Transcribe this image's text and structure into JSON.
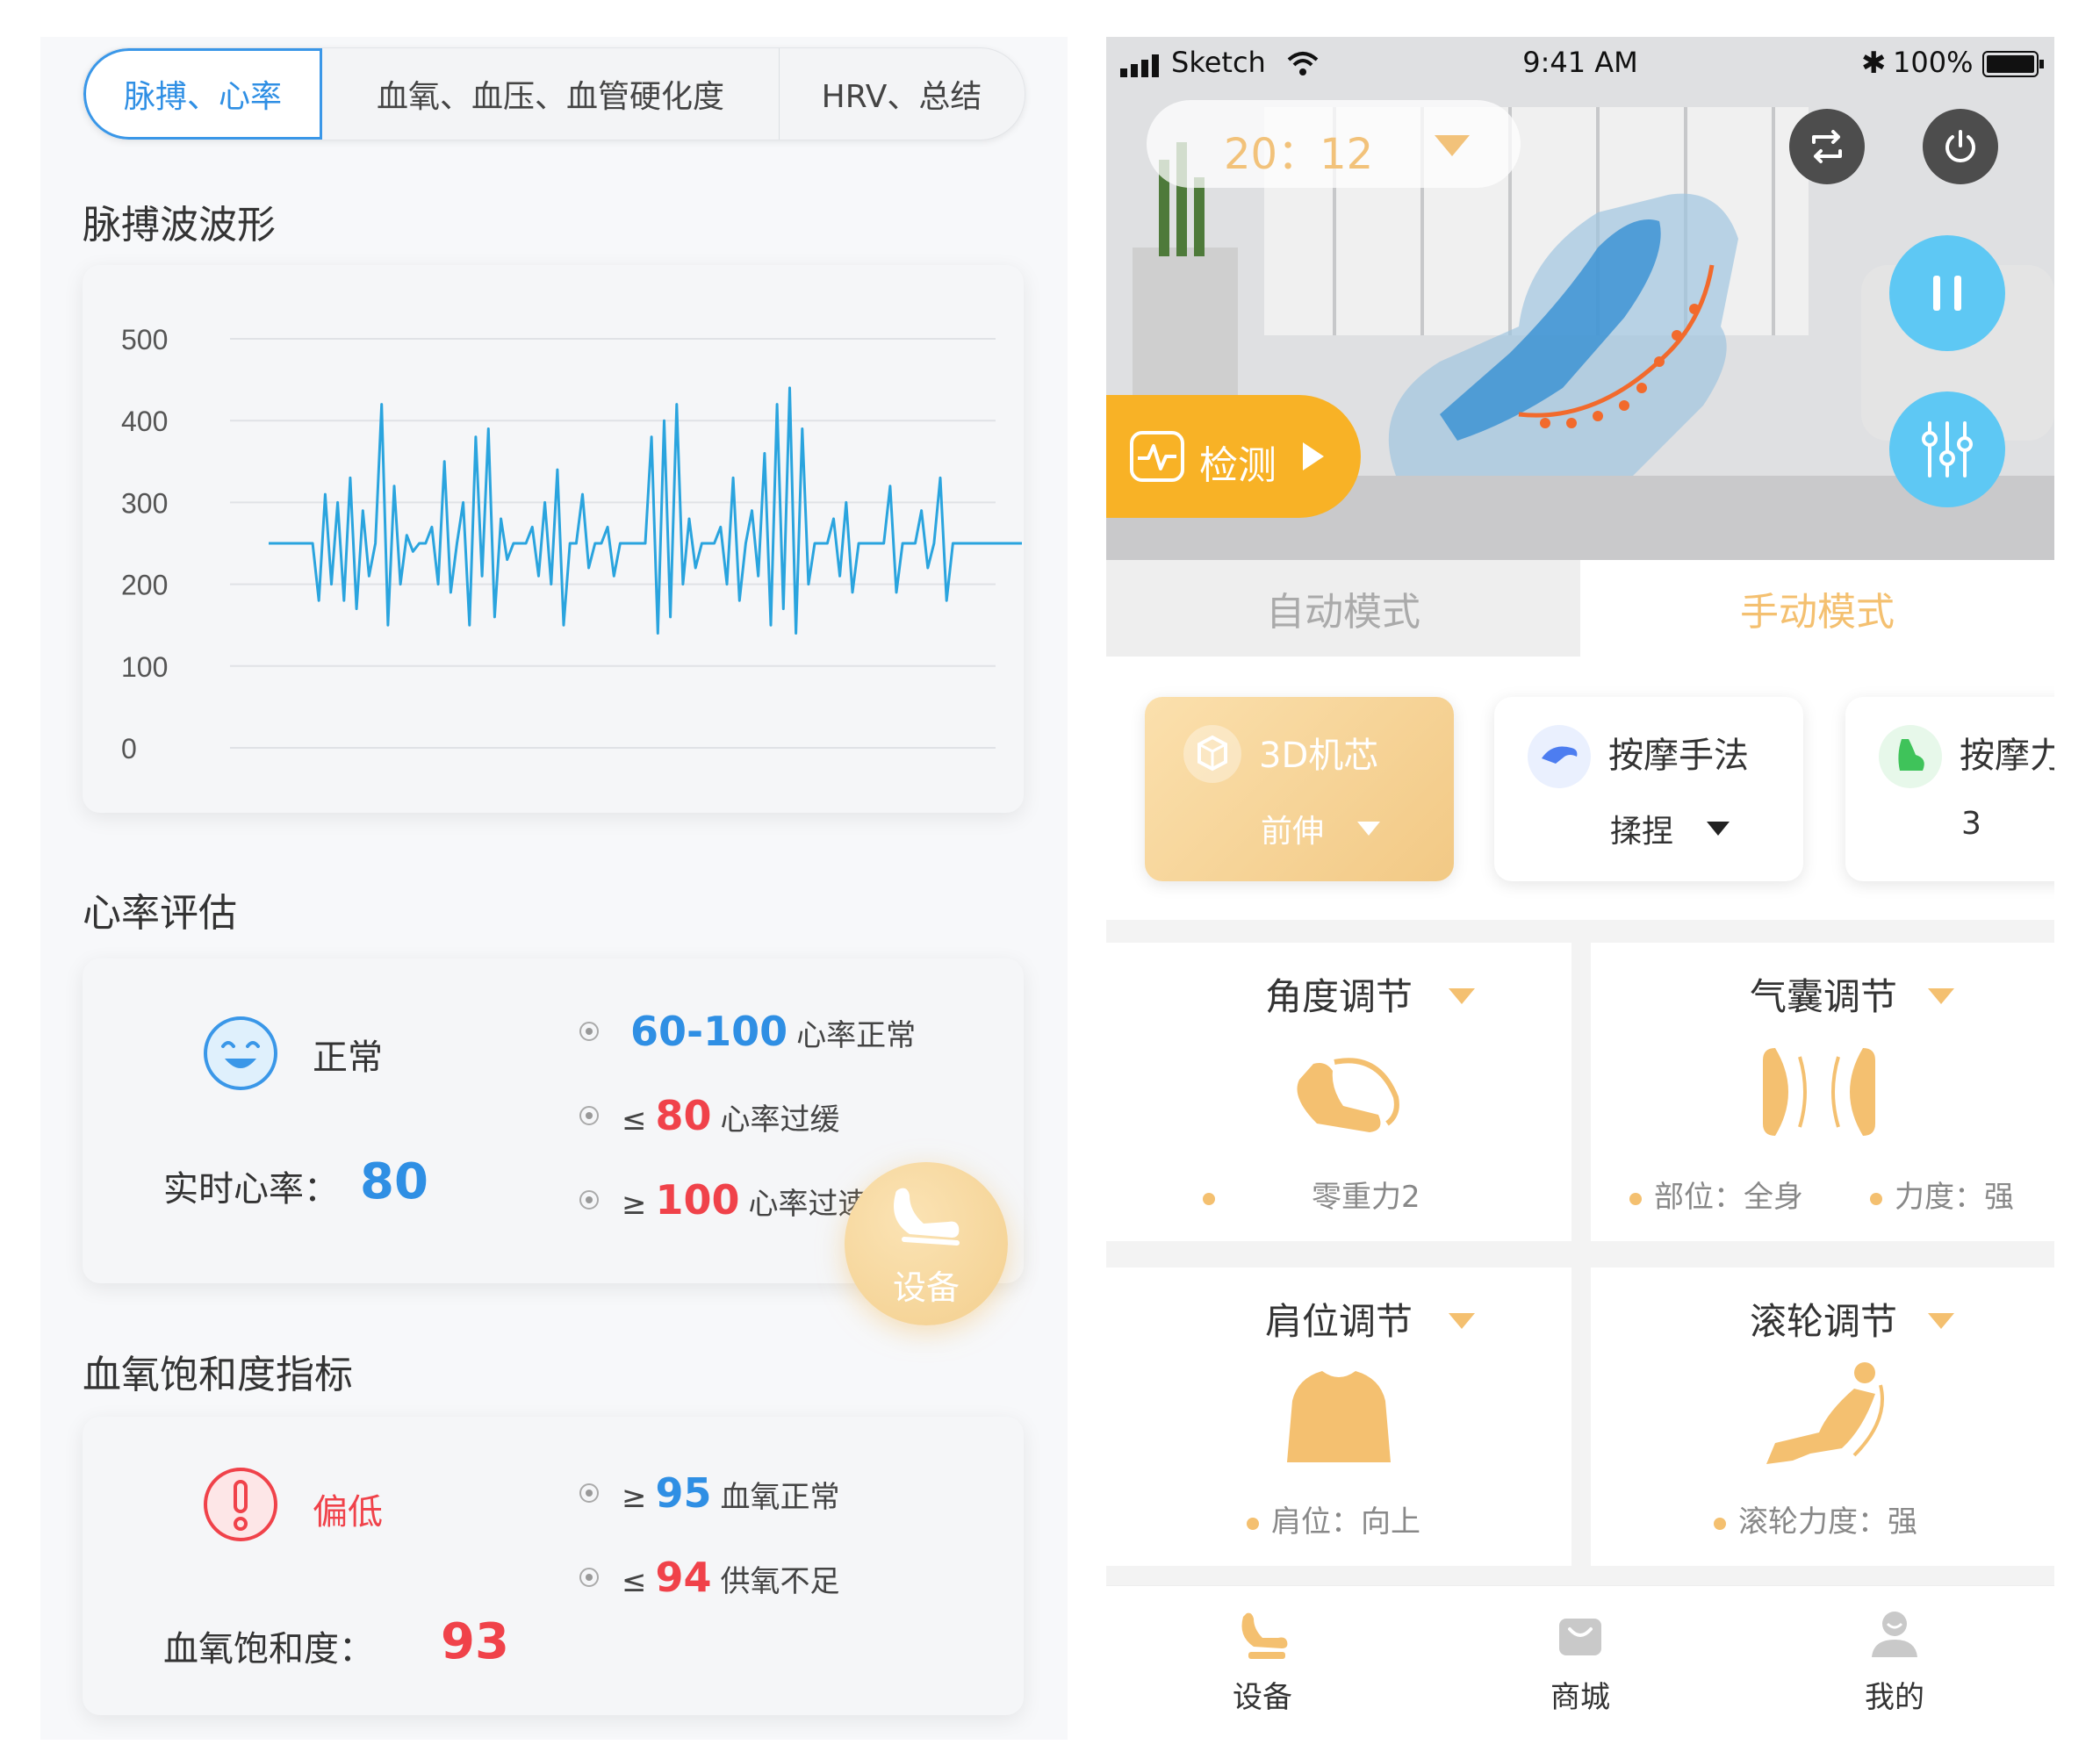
{
  "left": {
    "tabs": [
      {
        "label": "脉搏、心率"
      },
      {
        "label": "血氧、血压、血管硬化度"
      },
      {
        "label": "HRV、总结"
      }
    ],
    "waveform_title": "脉搏波波形",
    "hr_title": "心率评估",
    "hr": {
      "status": "正常",
      "live_label": "实时心率：",
      "live_value": "80",
      "rules": [
        {
          "prefix": "",
          "value": "60-100",
          "text": "心率正常"
        },
        {
          "prefix": "≤",
          "value": "80",
          "text": "心率过缓"
        },
        {
          "prefix": "≥",
          "value": "100",
          "text": "心率过速"
        }
      ]
    },
    "spo2_title": "血氧饱和度指标",
    "spo2": {
      "status": "偏低",
      "label": "血氧饱和度：",
      "value": "93",
      "rules": [
        {
          "prefix": "≥",
          "value": "95",
          "text": "血氧正常"
        },
        {
          "prefix": "≤",
          "value": "94",
          "text": "供氧不足"
        }
      ]
    },
    "fab_label": "设备"
  },
  "chart_data": {
    "type": "line",
    "ylim": [
      0,
      500
    ],
    "yticks": [
      "500",
      "400",
      "300",
      "200",
      "100",
      "0"
    ],
    "grid": true,
    "series": [
      {
        "values": [
          250,
          250,
          250,
          250,
          250,
          250,
          250,
          250,
          180,
          310,
          200,
          300,
          180,
          330,
          170,
          290,
          210,
          250,
          420,
          150,
          320,
          200,
          260,
          240,
          250,
          250,
          270,
          200,
          350,
          190,
          250,
          300,
          150,
          380,
          210,
          390,
          160,
          280,
          230,
          250,
          250,
          250,
          270,
          210,
          300,
          200,
          340,
          150,
          250,
          250,
          310,
          220,
          250,
          250,
          270,
          210,
          250,
          250,
          250,
          250,
          250,
          380,
          140,
          400,
          160,
          420,
          200,
          280,
          220,
          250,
          250,
          250,
          270,
          200,
          330,
          180,
          250,
          290,
          210,
          360,
          150,
          420,
          170,
          440,
          140,
          390,
          200,
          250,
          250,
          250,
          280,
          210,
          300,
          190,
          250,
          250,
          250,
          250,
          250,
          320,
          190,
          250,
          250,
          250,
          290,
          220,
          250,
          330,
          180,
          250,
          250,
          250,
          250,
          250,
          250,
          250,
          250,
          250,
          250,
          250,
          250
        ]
      }
    ]
  },
  "right": {
    "status": {
      "carrier": "Sketch",
      "time": "9:41 AM",
      "battery": "100%"
    },
    "timer": "20：12",
    "detect_label": "检测",
    "modes": {
      "auto": "自动模式",
      "manual": "手动模式"
    },
    "features": [
      {
        "title": "3D机芯",
        "value": "前伸"
      },
      {
        "title": "按摩手法",
        "value": "揉捏"
      },
      {
        "title": "按摩力度",
        "value": "3"
      }
    ],
    "adjust": [
      {
        "title": "角度调节",
        "info": [
          "零重力2"
        ]
      },
      {
        "title": "气囊调节",
        "info": [
          "部位：全身",
          "力度：强"
        ]
      },
      {
        "title": "肩位调节",
        "info": [
          "肩位：向上"
        ]
      },
      {
        "title": "滚轮调节",
        "info": [
          "滚轮力度：强"
        ]
      }
    ],
    "nav": [
      {
        "label": "设备"
      },
      {
        "label": "商城"
      },
      {
        "label": "我的"
      }
    ]
  },
  "colors": {
    "accent_blue": "#2f8fe4",
    "alert_red": "#f0424a",
    "wave": "#2aa4de",
    "gold": "#f4c070",
    "detect_orange": "#f8b226",
    "cyan": "#5ec8f4"
  },
  "icons": [
    "smile-icon",
    "exclamation-icon",
    "chair-icon",
    "swap-icon",
    "power-icon",
    "pause-icon",
    "sliders-icon",
    "pulse-icon",
    "3d-cube-icon",
    "hand-icon",
    "muscle-icon",
    "bag-icon",
    "user-icon"
  ]
}
